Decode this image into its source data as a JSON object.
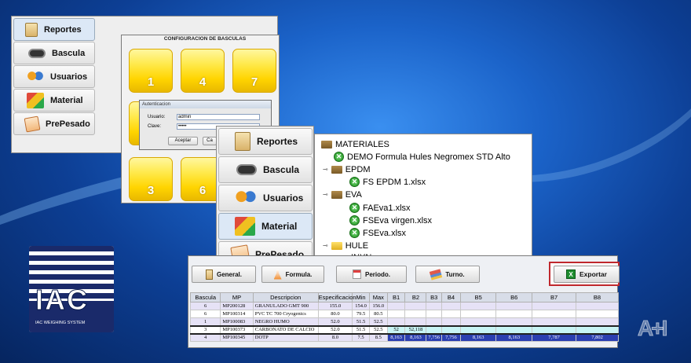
{
  "menu": {
    "items": [
      {
        "label": "Reportes"
      },
      {
        "label": "Bascula"
      },
      {
        "label": "Usuarios"
      },
      {
        "label": "Material"
      },
      {
        "label": "PrePesado"
      }
    ]
  },
  "scales": {
    "title": "CONFIGURACION DE BASCULAS",
    "tiles": [
      "1",
      "4",
      "7",
      "3",
      "6"
    ]
  },
  "auth": {
    "title": "Autenticacion",
    "user_label": "Usuario:",
    "user_value": "admin",
    "pass_label": "Clave:",
    "pass_value": "•••••",
    "accept": "Aceptar",
    "cancel": "Ca"
  },
  "tree": {
    "root": "MATERIALES",
    "items": [
      "DEMO Formula Hules Negromex STD Alto",
      "EPDM",
      "FS EPDM 1.xlsx",
      "EVA",
      "FAEva1.xlsx",
      "FSEva virgen.xlsx",
      "FSEva.xlsx",
      "HULE",
      "INYN"
    ]
  },
  "toolbar": {
    "general": "General.",
    "formula": "Formula.",
    "periodo": "Periodo.",
    "turno": "Turno.",
    "exportar": "Exportar"
  },
  "table": {
    "headers": [
      "Bascula",
      "MP",
      "Descripcion",
      "Especificacion",
      "Min",
      "Max",
      "B1",
      "B2",
      "B3",
      "B4",
      "B5",
      "B6",
      "B7",
      "B8"
    ],
    "rows": [
      [
        "6",
        "MP200128",
        "GRANULADO GMT 900",
        "155.0",
        "154.0",
        "156.0",
        "",
        "",
        "",
        "",
        "",
        "",
        "",
        ""
      ],
      [
        "6",
        "MP100314",
        "PVC TC 700 Cryogenics",
        "80.0",
        "79.5",
        "80.5",
        "",
        "",
        "",
        "",
        "",
        "",
        "",
        ""
      ],
      [
        "1",
        "MP100083",
        "NEGRO HUMO",
        "52.0",
        "51.5",
        "52.5",
        "",
        "",
        "",
        "",
        "",
        "",
        "",
        ""
      ],
      [
        "3",
        "MP100373",
        "CARBONATO DE CALCIO",
        "52.0",
        "51.5",
        "52.5",
        "52",
        "52,118",
        "",
        "",
        "",
        "",
        "",
        ""
      ],
      [
        "4",
        "MP100345",
        "DOTP",
        "8.0",
        "7.5",
        "8.5",
        "8,163",
        "8,163",
        "7,756",
        "7,756",
        "8,163",
        "8,163",
        "7,787",
        "7,802"
      ]
    ]
  },
  "logo": {
    "brand": "IAC",
    "tagline": "IAC WEIGHING SYSTEM"
  },
  "watermark": "A+I",
  "colors": {
    "accent_border": "#c0282d",
    "tile_yellow": "#ffd400",
    "row_highlight": "#2b3fb0"
  }
}
